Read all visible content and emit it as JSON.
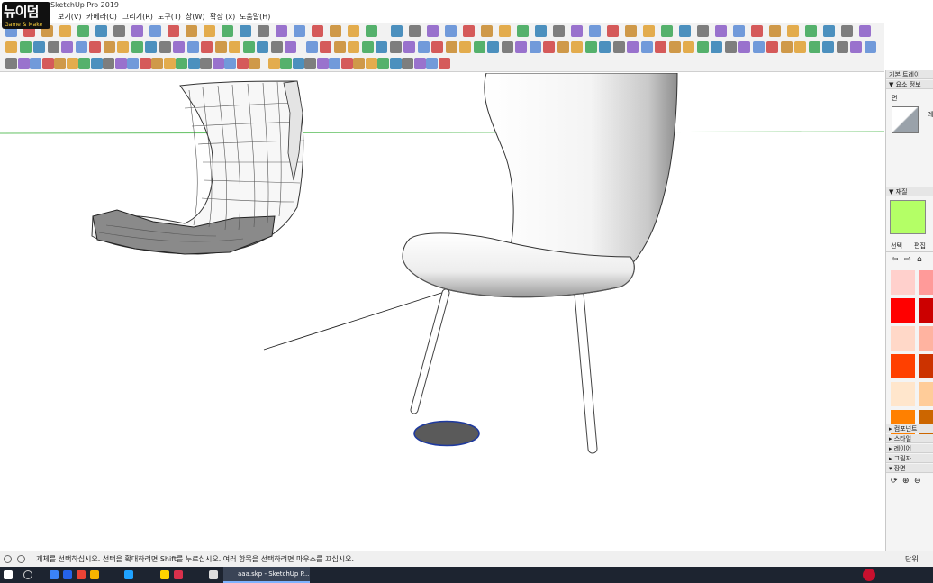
{
  "window": {
    "title": "SketchUp Pro 2019"
  },
  "logo": {
    "text": "뉴이덤",
    "tagline": "Game & Make"
  },
  "menu": [
    {
      "label": "보기(V)"
    },
    {
      "label": "카메라(C)"
    },
    {
      "label": "그리기(R)"
    },
    {
      "label": "도구(T)"
    },
    {
      "label": "창(W)"
    },
    {
      "label": "확장 (x)"
    },
    {
      "label": "도움말(H)"
    }
  ],
  "tray": {
    "title": "기본 트레이",
    "entity_info": {
      "header": "▼ 요소 정보",
      "label": "면",
      "side_label": "레"
    },
    "materials": {
      "header": "▼ 재질",
      "current_color": "#b4ff66",
      "tab_select": "선택",
      "tab_edit": "편집",
      "swatches": [
        "#ffd0cc",
        "#ff9a99",
        "#ff0000",
        "#cc0000",
        "#ffd8c8",
        "#ffb3a0",
        "#ff4000",
        "#cc3300",
        "#ffe6cc",
        "#ffcc99",
        "#ff8000",
        "#cc6600"
      ]
    },
    "panels": [
      {
        "label": "▸ 컴포넌트"
      },
      {
        "label": "▸ 스타일"
      },
      {
        "label": "▸ 레이어"
      },
      {
        "label": "▸ 그림자"
      },
      {
        "label": "▾ 장면"
      }
    ]
  },
  "status": {
    "message": "개체를 선택하십시오. 선택을 확대하려면 Shift를 누르십시오. 여러 항목을 선택하려면 마우스를 끄십시오.",
    "unit_label": "단위"
  },
  "taskbar": {
    "active_app": "aaa.skp - SketchUp P..."
  },
  "colors": {
    "horizon_line": "#63c163",
    "selected_face": "#5a5a5a",
    "selected_outline": "#1f3a9e",
    "accent": "#b4ff66"
  }
}
